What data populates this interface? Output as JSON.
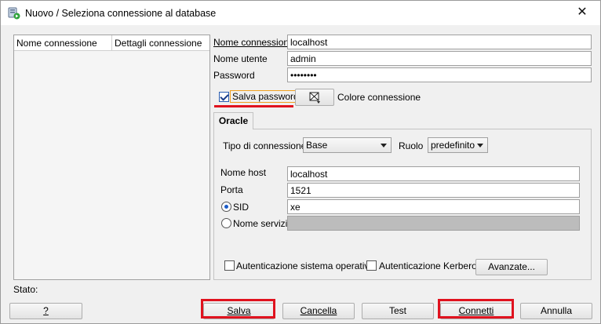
{
  "window": {
    "title": "Nuovo / Seleziona connessione al database",
    "app_icon": "database-connect-icon",
    "close_icon": "close-icon"
  },
  "list": {
    "columns": [
      "Nome connessione",
      "Dettagli connessione"
    ]
  },
  "form": {
    "connection_name_label": "Nome connessione",
    "connection_name_value": "localhost",
    "username_label": "Nome utente",
    "username_value": "admin",
    "password_label": "Password",
    "password_value": "••••••••",
    "save_password_label": "Salva password",
    "save_password_checked": true,
    "color_label": "Colore connessione",
    "color_icon": "color-picker-icon"
  },
  "tabs": [
    {
      "label": "Oracle",
      "selected": true
    }
  ],
  "oracle": {
    "connection_type_label": "Tipo di connessione",
    "connection_type_value": "Base",
    "role_label": "Ruolo",
    "role_value": "predefinito",
    "hostname_label": "Nome host",
    "hostname_value": "localhost",
    "port_label": "Porta",
    "port_value": "1521",
    "sid_label": "SID",
    "sid_value": "xe",
    "sid_selected": true,
    "service_name_label": "Nome servizio",
    "service_name_value": "",
    "os_auth_label": "Autenticazione sistema operativo",
    "kerberos_auth_label": "Autenticazione Kerberos",
    "advanced_label": "Avanzate..."
  },
  "status": {
    "label": "Stato:"
  },
  "buttons": {
    "help": "?",
    "save": "Salva",
    "cancel": "Cancella",
    "test": "Test",
    "connect": "Connetti",
    "close": "Annulla"
  },
  "colors": {
    "highlight": "#e0121e",
    "checkbox_focus": "#f0a020"
  }
}
